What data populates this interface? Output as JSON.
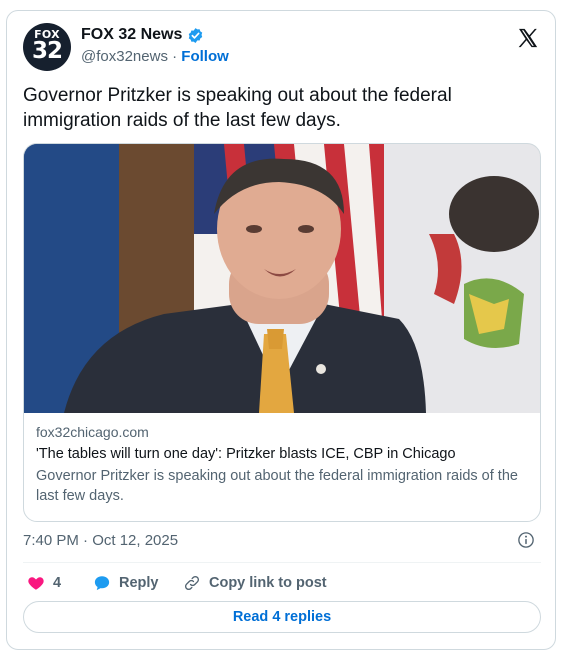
{
  "account": {
    "display_name": "FOX 32 News",
    "handle": "@fox32news",
    "separator": "·",
    "follow_label": "Follow",
    "avatar": {
      "line1": "FOX",
      "line2": "32",
      "bg": "#16202e"
    },
    "verified": true,
    "verified_color": "#1d9bf0"
  },
  "tweet": {
    "text": "Governor Pritzker is speaking out about the federal immigration raids of the last few days."
  },
  "link_card": {
    "image_alt": "Governor Pritzker speaking in front of American and Illinois flags",
    "domain": "fox32chicago.com",
    "title": "'The tables will turn one day': Pritzker blasts ICE, CBP in Chicago",
    "description": "Governor Pritzker is speaking out about the federal immigration raids of the last few days."
  },
  "meta": {
    "timestamp": "7:40 PM · Oct 12, 2025"
  },
  "actions": {
    "like_count": "4",
    "reply_label": "Reply",
    "copy_link_label": "Copy link to post",
    "read_replies_label": "Read 4 replies"
  },
  "icons": {
    "brand": "x-logo-icon",
    "verified": "verified-badge-icon",
    "info": "info-icon",
    "like": "heart-icon",
    "reply": "speech-bubble-icon",
    "copy": "link-icon"
  },
  "colors": {
    "like": "#f91880",
    "reply": "#1d9bf0",
    "link": "#006fd6",
    "secondary_text": "#536471",
    "border": "#cfd9de"
  }
}
